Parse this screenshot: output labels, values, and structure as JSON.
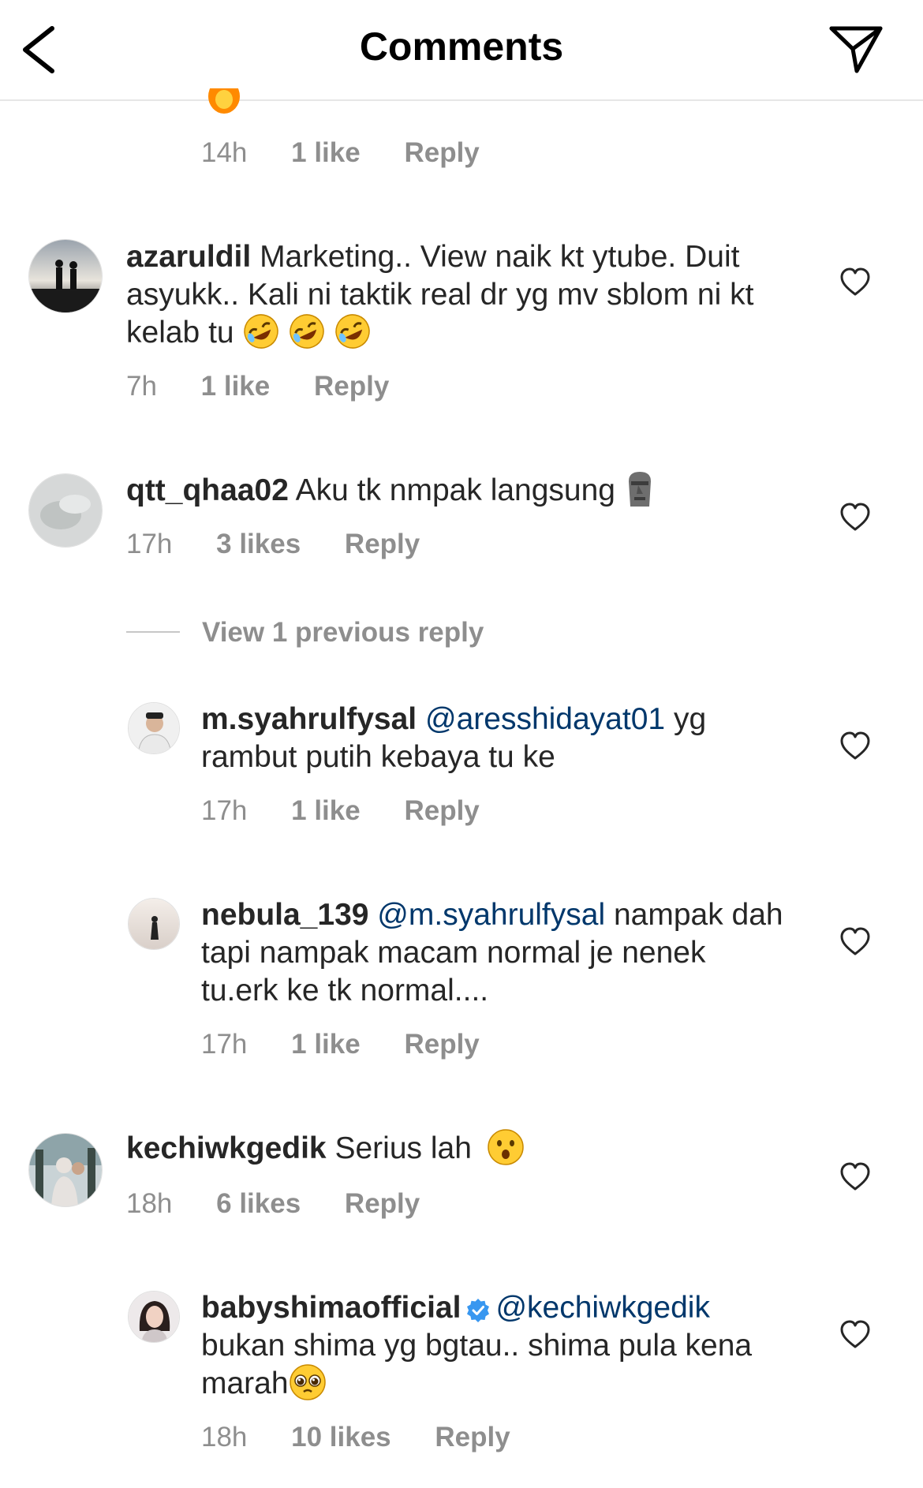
{
  "header": {
    "title": "Comments"
  },
  "top_comment": {
    "time": "14h",
    "likes": "1 like",
    "reply": "Reply"
  },
  "comments": [
    {
      "username": "azaruldil",
      "text": "Marketing.. View naik kt ytube. Duit asyukk.. Kali ni taktik real dr yg mv sblom ni kt kelab tu",
      "emojis": [
        "rolling-laughing-emoji",
        "rolling-laughing-emoji",
        "rolling-laughing-emoji"
      ],
      "time": "7h",
      "likes": "1 like",
      "reply": "Reply"
    },
    {
      "username": "qtt_qhaa02",
      "text": "Aku tk nmpak langsung",
      "emojis": [
        "moai-emoji"
      ],
      "time": "17h",
      "likes": "3 likes",
      "reply": "Reply",
      "view_replies": "View 1 previous reply",
      "replies": [
        {
          "username": "m.syahrulfysal",
          "mention": "@aresshidayat01",
          "text": "yg rambut putih kebaya tu ke",
          "time": "17h",
          "likes": "1 like",
          "reply": "Reply"
        },
        {
          "username": "nebula_139",
          "mention": "@m.syahrulfysal",
          "text": "nampak dah tapi nampak macam normal je nenek tu.erk ke tk normal....",
          "time": "17h",
          "likes": "1 like",
          "reply": "Reply"
        }
      ]
    },
    {
      "username": "kechiwkgedik",
      "text": "Serius lah",
      "emojis": [
        "astonished-face-emoji"
      ],
      "time": "18h",
      "likes": "6 likes",
      "reply": "Reply",
      "replies": [
        {
          "username": "babyshimaofficial",
          "verified": true,
          "mention": "@kechiwkgedik",
          "text": "bukan shima yg bgtau.. shima pula kena marah",
          "emojis": [
            "pleading-face-emoji"
          ],
          "time": "18h",
          "likes": "10 likes",
          "reply": "Reply"
        }
      ]
    }
  ],
  "colors": {
    "text": "#262626",
    "meta": "#8e8e8e",
    "mention": "#00376b",
    "verified": "#3897f0"
  }
}
